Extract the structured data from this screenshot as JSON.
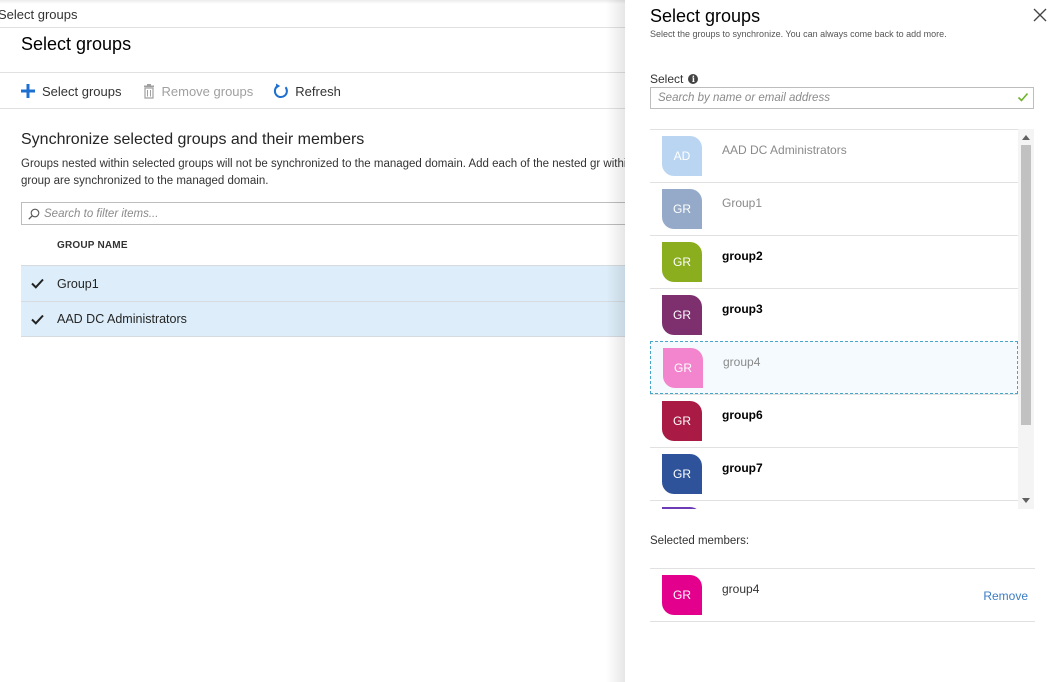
{
  "breadcrumb": "Select groups",
  "blade": {
    "title": "Select groups",
    "toolbar": {
      "select_label": "Select groups",
      "remove_label": "Remove groups",
      "refresh_label": "Refresh"
    },
    "heading": "Synchronize selected groups and their members",
    "description": "Groups nested within selected groups will not be synchronized to the managed domain. Add each of the nested gr within that group are synchronized to the managed domain.",
    "filter_placeholder": "Search to filter items...",
    "column_header": "GROUP NAME",
    "rows": [
      {
        "label": "Group1",
        "checked": true
      },
      {
        "label": "AAD DC Administrators",
        "checked": true
      }
    ]
  },
  "panel": {
    "title": "Select groups",
    "subtitle": "Select the groups to synchronize. You can always come back to add more.",
    "select_label": "Select",
    "search_placeholder": "Search by name or email address",
    "items": [
      {
        "initials": "AD",
        "label": "AAD DC Administrators",
        "color": "#b9d5f2",
        "state": "selected"
      },
      {
        "initials": "GR",
        "label": "Group1",
        "color": "#94aac8",
        "state": "selected"
      },
      {
        "initials": "GR",
        "label": "group2",
        "color": "#8aae1d",
        "state": "available"
      },
      {
        "initials": "GR",
        "label": "group3",
        "color": "#7d2f6e",
        "state": "available"
      },
      {
        "initials": "GR",
        "label": "group4",
        "color": "#f285cd",
        "state": "selected"
      },
      {
        "initials": "GR",
        "label": "group6",
        "color": "#a91a45",
        "state": "available"
      },
      {
        "initials": "GR",
        "label": "group7",
        "color": "#2e539a",
        "state": "available"
      },
      {
        "initials": "",
        "label": "",
        "color": "#6c3bb5",
        "state": "available"
      }
    ],
    "members_label": "Selected members:",
    "member": {
      "initials": "GR",
      "name": "group4",
      "color": "#e3008c"
    },
    "remove_label": "Remove"
  }
}
